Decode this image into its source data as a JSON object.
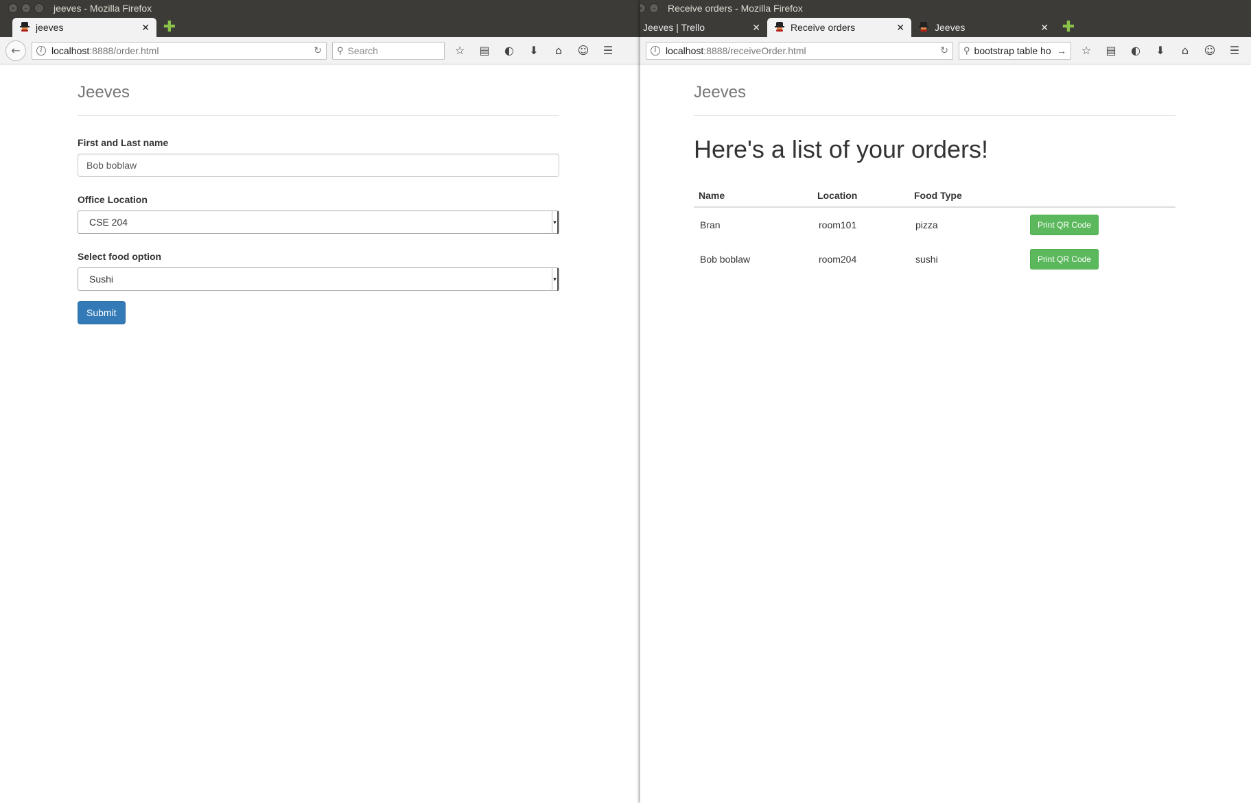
{
  "left_window": {
    "title": "jeeves - Mozilla Firefox",
    "tabs": [
      {
        "label": "jeeves",
        "active": true
      }
    ],
    "url_host": "localhost",
    "url_path": ":8888/order.html",
    "search_placeholder": "Search",
    "page": {
      "brand": "Jeeves",
      "name_label": "First and Last name",
      "name_value": "Bob boblaw",
      "location_label": "Office Location",
      "location_value": "CSE 204",
      "food_label": "Select food option",
      "food_value": "Sushi",
      "submit_label": "Submit"
    }
  },
  "right_window": {
    "title": "Receive orders - Mozilla Firefox",
    "tabs": [
      {
        "label": "Jeeves | Trello",
        "active": false
      },
      {
        "label": "Receive orders",
        "active": true
      },
      {
        "label": "Jeeves",
        "active": false
      }
    ],
    "url_host": "localhost",
    "url_path": ":8888/receiveOrder.html",
    "search_value": "bootstrap table ho",
    "page": {
      "brand": "Jeeves",
      "heading": "Here's a list of your orders!",
      "columns": [
        "Name",
        "Location",
        "Food Type"
      ],
      "rows": [
        {
          "name": "Bran",
          "location": "room101",
          "food": "pizza",
          "action": "Print QR Code"
        },
        {
          "name": "Bob boblaw",
          "location": "room204",
          "food": "sushi",
          "action": "Print QR Code"
        }
      ]
    }
  },
  "colors": {
    "primary": "#337ab7",
    "success": "#5cb85c",
    "titlebar": "#3c3b37"
  }
}
